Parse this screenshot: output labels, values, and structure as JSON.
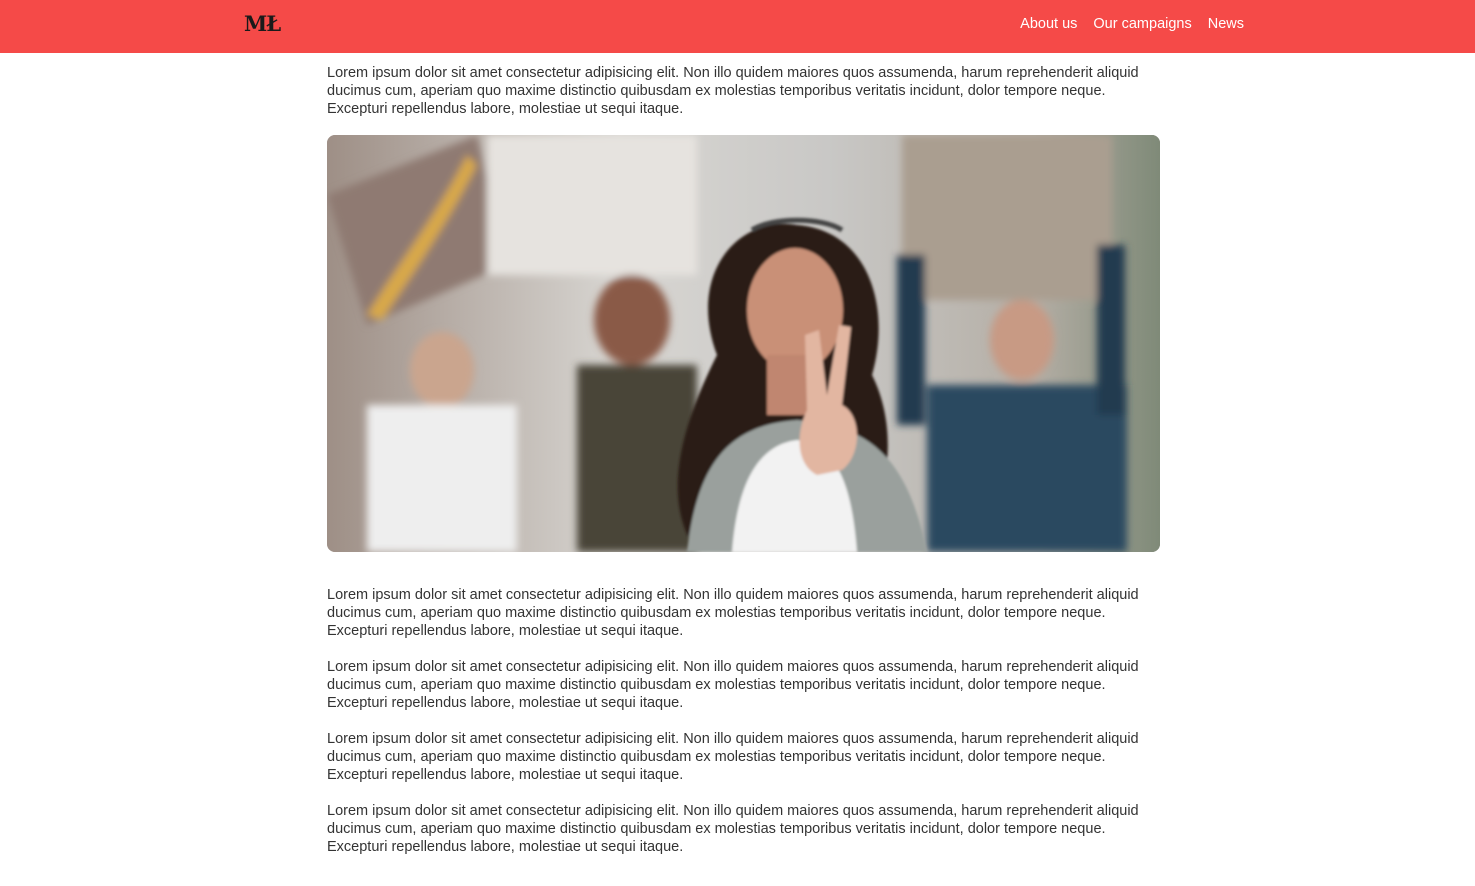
{
  "header": {
    "logo": "MŁ",
    "nav": [
      {
        "label": "About us"
      },
      {
        "label": "Our campaigns"
      },
      {
        "label": "News"
      }
    ],
    "background": "#f54a48"
  },
  "main": {
    "paragraphs": [
      "Lorem ipsum dolor sit amet consectetur adipisicing elit. Non illo quidem maiores quos assumenda, harum reprehenderit aliquid ducimus cum, aperiam quo maxime distinctio quibusdam ex molestias temporibus veritatis incidunt, dolor tempore neque. Excepturi repellendus labore, molestiae ut sequi itaque.",
      "Lorem ipsum dolor sit amet consectetur adipisicing elit. Non illo quidem maiores quos assumenda, harum reprehenderit aliquid ducimus cum, aperiam quo maxime distinctio quibusdam ex molestias temporibus veritatis incidunt, dolor tempore neque. Excepturi repellendus labore, molestiae ut sequi itaque.",
      "Lorem ipsum dolor sit amet consectetur adipisicing elit. Non illo quidem maiores quos assumenda, harum reprehenderit aliquid ducimus cum, aperiam quo maxime distinctio quibusdam ex molestias temporibus veritatis incidunt, dolor tempore neque. Excepturi repellendus labore, molestiae ut sequi itaque.",
      "Lorem ipsum dolor sit amet consectetur adipisicing elit. Non illo quidem maiores quos assumenda, harum reprehenderit aliquid ducimus cum, aperiam quo maxime distinctio quibusdam ex molestias temporibus veritatis incidunt, dolor tempore neque. Excepturi repellendus labore, molestiae ut sequi itaque.",
      "Lorem ipsum dolor sit amet consectetur adipisicing elit. Non illo quidem maiores quos assumenda, harum reprehenderit aliquid ducimus cum, aperiam quo maxime distinctio quibusdam ex molestias temporibus veritatis incidunt, dolor tempore neque. Excepturi repellendus labore, molestiae ut sequi itaque."
    ],
    "photo": {
      "icon": "protest-photo-illustration"
    }
  }
}
